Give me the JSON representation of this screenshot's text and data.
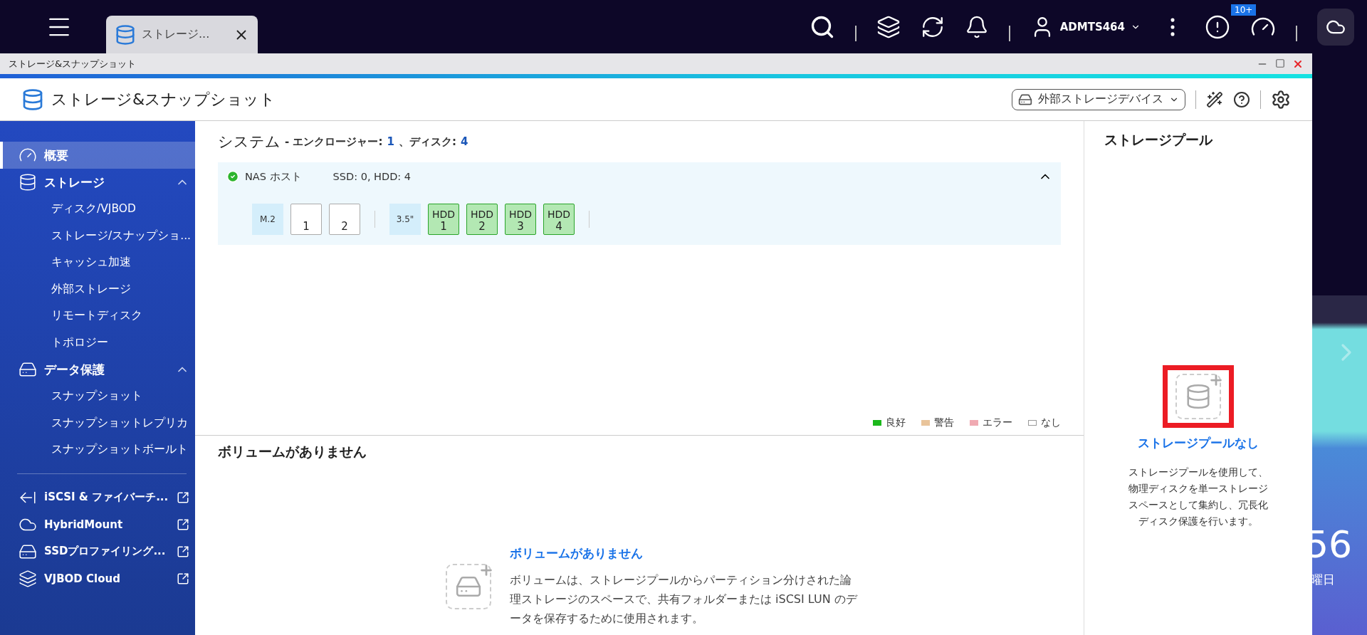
{
  "desktop": {
    "tab": {
      "title": "ストレージ..."
    },
    "user": "ADMTS464",
    "badge": "10+",
    "clock": "56",
    "weekday": "曜日"
  },
  "window": {
    "title": "ストレージ&スナップショット"
  },
  "header": {
    "title": "ストレージ&スナップショット",
    "device_menu": "外部ストレージデバイス"
  },
  "sidebar": {
    "items": [
      {
        "label": "概要",
        "kind": "page",
        "selected": true
      },
      {
        "label": "ストレージ",
        "kind": "group",
        "expanded": true,
        "children": [
          {
            "label": "ディスク/VJBOD",
            "selected": false
          },
          {
            "label": "ストレージ/スナップショ...",
            "selected": false
          },
          {
            "label": "キャッシュ加速",
            "selected": false
          },
          {
            "label": "外部ストレージ",
            "selected": false
          },
          {
            "label": "リモートディスク",
            "selected": false
          },
          {
            "label": "トポロジー",
            "selected": false
          }
        ]
      },
      {
        "label": "データ保護",
        "kind": "group",
        "expanded": true,
        "children": [
          {
            "label": "スナップショット",
            "selected": false
          },
          {
            "label": "スナップショットレプリカ",
            "selected": false
          },
          {
            "label": "スナップショットボールト",
            "selected": false
          }
        ]
      },
      {
        "label": "iSCSI & ファイバーチ...",
        "kind": "external",
        "selected": false
      },
      {
        "label": "HybridMount",
        "kind": "external",
        "selected": false
      },
      {
        "label": "SSDプロファイリング...",
        "kind": "external",
        "selected": false
      },
      {
        "label": "VJBOD Cloud",
        "kind": "external",
        "selected": false
      }
    ]
  },
  "system": {
    "title": "システム",
    "enclosure_label": "- エンクロージャー:",
    "enclosure_count": "1",
    "disk_label": "、ディスク:",
    "disk_count": "4",
    "enclosures": [
      {
        "name": "NAS ホスト",
        "healthy": true,
        "summary": "SSD: 0, HDD: 4",
        "expanded": true,
        "groups": [
          {
            "label": "M.2",
            "slots": [
              {
                "number": "1",
                "color": "#ffffff"
              },
              {
                "number": "2",
                "color": "#ffffff"
              }
            ]
          },
          {
            "label": "3.5\"",
            "slots": [
              {
                "type": "HDD",
                "number": "1",
                "color": "#b3e8b3"
              },
              {
                "type": "HDD",
                "number": "2",
                "color": "#b3e8b3"
              },
              {
                "type": "HDD",
                "number": "3",
                "color": "#b3e8b3"
              },
              {
                "type": "HDD",
                "number": "4",
                "color": "#b3e8b3"
              }
            ]
          }
        ]
      }
    ],
    "legend": [
      {
        "label": "良好",
        "color": "#1bb81b"
      },
      {
        "label": "警告",
        "color": "#e9c49b"
      },
      {
        "label": "エラー",
        "color": "#f0aab2"
      },
      {
        "label": "なし",
        "color": "#ffffff"
      }
    ]
  },
  "volumes": {
    "heading": "ボリュームがありません",
    "empty_title": "ボリュームがありません",
    "empty_text": "ボリュームは、ストレージプールからパーティション分けされた論理ストレージのスペースで、共有フォルダーまたは iSCSI LUN のデータを保存するために使用されます。"
  },
  "pools": {
    "title": "ストレージプール",
    "empty_title": "ストレージプールなし",
    "empty_text": "ストレージプールを使用して、物理ディスクを単一ストレージスペースとして集約し、冗長化ディスク保護を行います。",
    "highlighted": true
  }
}
